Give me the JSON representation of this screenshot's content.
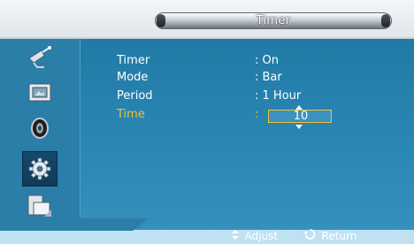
{
  "window": {
    "title": "Timer"
  },
  "sidebar": {
    "items": [
      {
        "icon": "satellite-dish-icon"
      },
      {
        "icon": "picture-icon"
      },
      {
        "icon": "sound-icon"
      },
      {
        "icon": "gear-icon",
        "selected": true
      },
      {
        "icon": "multi-screen-icon"
      }
    ]
  },
  "settings": {
    "rows": [
      {
        "label": "Timer",
        "value": ": On"
      },
      {
        "label": "Mode",
        "value": ": Bar"
      },
      {
        "label": "Period",
        "value": ": 1 Hour"
      },
      {
        "label": "Time",
        "value": ":"
      }
    ],
    "time_value": "10"
  },
  "footer": {
    "adjust_icon": "up-down-arrow-icon",
    "adjust_label": "Adjust",
    "return_icon": "return-icon",
    "return_label": "Return"
  },
  "colors": {
    "panel": "#2a86b3",
    "highlight": "#f2c22e",
    "footer_bar": "#bfe2f3"
  }
}
